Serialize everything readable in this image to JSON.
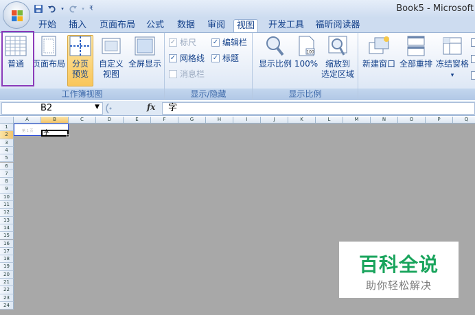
{
  "window": {
    "title": "Book5 - Microsoft"
  },
  "tabs": [
    {
      "label": "开始",
      "active": false
    },
    {
      "label": "插入",
      "active": false
    },
    {
      "label": "页面布局",
      "active": false
    },
    {
      "label": "公式",
      "active": false
    },
    {
      "label": "数据",
      "active": false
    },
    {
      "label": "审阅",
      "active": false
    },
    {
      "label": "视图",
      "active": true
    },
    {
      "label": "开发工具",
      "active": false
    },
    {
      "label": "福昕阅读器",
      "active": false
    }
  ],
  "ribbon": {
    "workbook_views": {
      "label": "工作簿视图",
      "normal": "普通",
      "page_layout": "页面布局",
      "page_break_1": "分页",
      "page_break_2": "预览",
      "custom_1": "自定义",
      "custom_2": "视图",
      "fullscreen": "全屏显示"
    },
    "show_hide": {
      "label": "显示/隐藏",
      "ruler": "标尺",
      "formula_bar": "编辑栏",
      "gridlines": "网格线",
      "headings": "标题",
      "message_bar": "消息栏"
    },
    "zoom": {
      "label": "显示比例",
      "zoom": "显示比例",
      "hundred": "100%",
      "zoom_sel_1": "缩放到",
      "zoom_sel_2": "选定区域",
      "hundred_icon_text": "100"
    },
    "window": {
      "new_window": "新建窗口",
      "arrange_all": "全部重排",
      "freeze": "冻结窗格",
      "freeze_arrow": "▾"
    }
  },
  "formula_bar": {
    "name_box": "B2",
    "fx": "fx",
    "content": "字"
  },
  "sheet": {
    "columns": [
      "A",
      "B",
      "C",
      "D",
      "E",
      "F",
      "G",
      "H",
      "I",
      "J",
      "K",
      "L",
      "M",
      "N",
      "O",
      "P",
      "Q"
    ],
    "rows": [
      "1",
      "2",
      "3",
      "4",
      "5",
      "6",
      "7",
      "8",
      "9",
      "10",
      "11",
      "12",
      "13",
      "14",
      "15",
      "16",
      "17",
      "18",
      "19",
      "20",
      "21",
      "22",
      "23",
      "24"
    ],
    "selected_column": "B",
    "selected_row": "2",
    "cell_b2": "字",
    "page_mark": "第 1 页"
  },
  "watermark": {
    "title": "百科全说",
    "subtitle": "助你轻松解决"
  },
  "colors": {
    "accent": "#15428b",
    "highlight": "#8a3ab9",
    "watermark": "#19a45c"
  }
}
